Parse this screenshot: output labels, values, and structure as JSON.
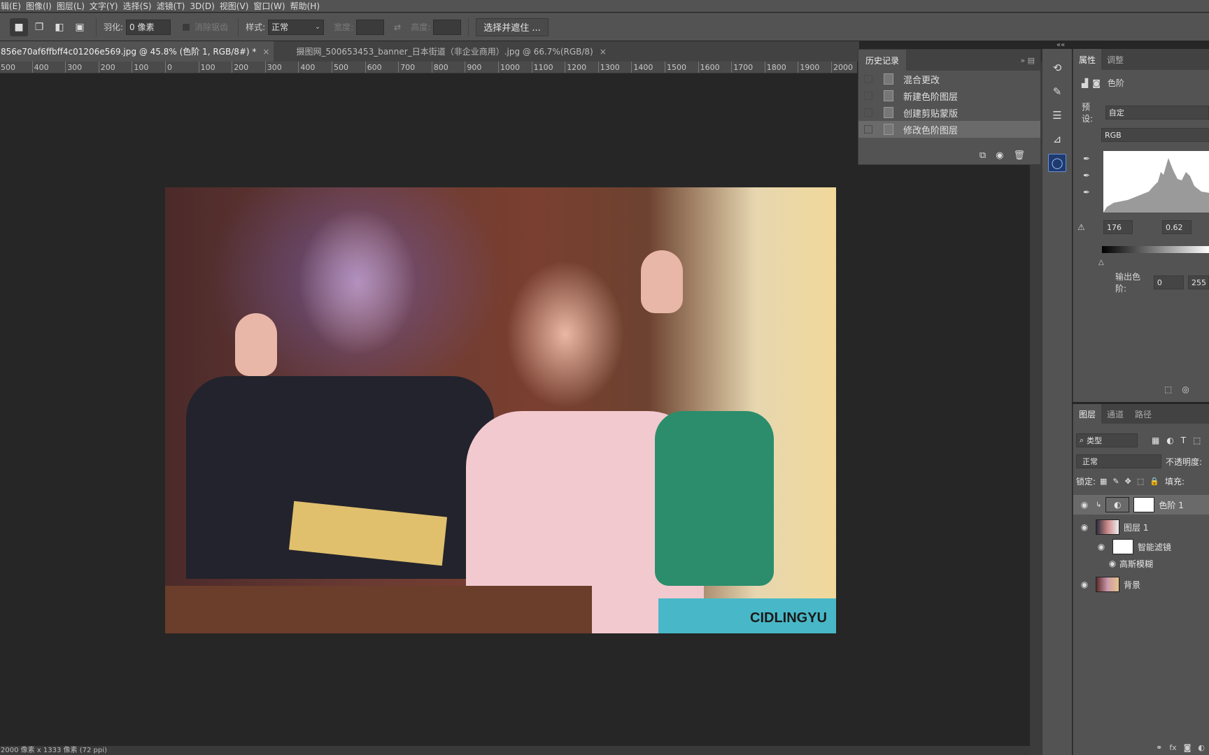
{
  "menubar": [
    "辑(E)",
    "图像(I)",
    "图层(L)",
    "文字(Y)",
    "选择(S)",
    "滤镜(T)",
    "3D(D)",
    "视图(V)",
    "窗口(W)",
    "帮助(H)"
  ],
  "options": {
    "feather_label": "羽化:",
    "feather_value": "0 像素",
    "antialias_label": "消除锯齿",
    "style_label": "样式:",
    "style_value": "正常",
    "width_label": "宽度:",
    "height_label": "高度:",
    "select_mask_button": "选择并遮住 ..."
  },
  "tabs": [
    {
      "label": "856e70af6ffbff4c01206e569.jpg @ 45.8% (色阶 1, RGB/8#) *",
      "close": "×"
    },
    {
      "label": "摄图网_500653453_banner_日本街道（非企业商用）.jpg @ 66.7%(RGB/8)",
      "close": "×"
    }
  ],
  "ruler": [
    "500",
    "400",
    "300",
    "200",
    "100",
    "0",
    "100",
    "200",
    "300",
    "400",
    "500",
    "600",
    "700",
    "800",
    "900",
    "1000",
    "1100",
    "1200",
    "1300",
    "1400",
    "1500",
    "1600",
    "1700",
    "1800",
    "1900",
    "2000"
  ],
  "photo": {
    "watermark": "CIDLINGYU"
  },
  "status": "2000 像素 x 1333 像素 (72 ppi)",
  "history": {
    "title": "历史记录",
    "items": [
      "混合更改",
      "新建色阶图层",
      "创建剪贴蒙版",
      "修改色阶图层"
    ],
    "current_index": 3
  },
  "properties": {
    "tab_properties": "属性",
    "tab_adjust": "调整",
    "layer_type": "色阶",
    "preset_label": "预设:",
    "preset_value": "自定",
    "channel": "RGB",
    "input_black": "176",
    "input_gamma": "0.62",
    "output_label": "输出色阶:",
    "output_black": "0",
    "output_white": "255"
  },
  "layers": {
    "tabs": [
      "图层",
      "通道",
      "路径"
    ],
    "filter_label": "类型",
    "blend_mode": "正常",
    "opacity_label": "不透明度:",
    "lock_label": "锁定:",
    "fill_label": "填充:",
    "items": [
      {
        "name": "色阶 1",
        "kind": "adjustment"
      },
      {
        "name": "图层 1",
        "kind": "smart"
      },
      {
        "name": "智能滤镜",
        "kind": "filter-mask"
      },
      {
        "name": "高斯模糊",
        "kind": "filter"
      },
      {
        "name": "背景",
        "kind": "background"
      }
    ]
  }
}
